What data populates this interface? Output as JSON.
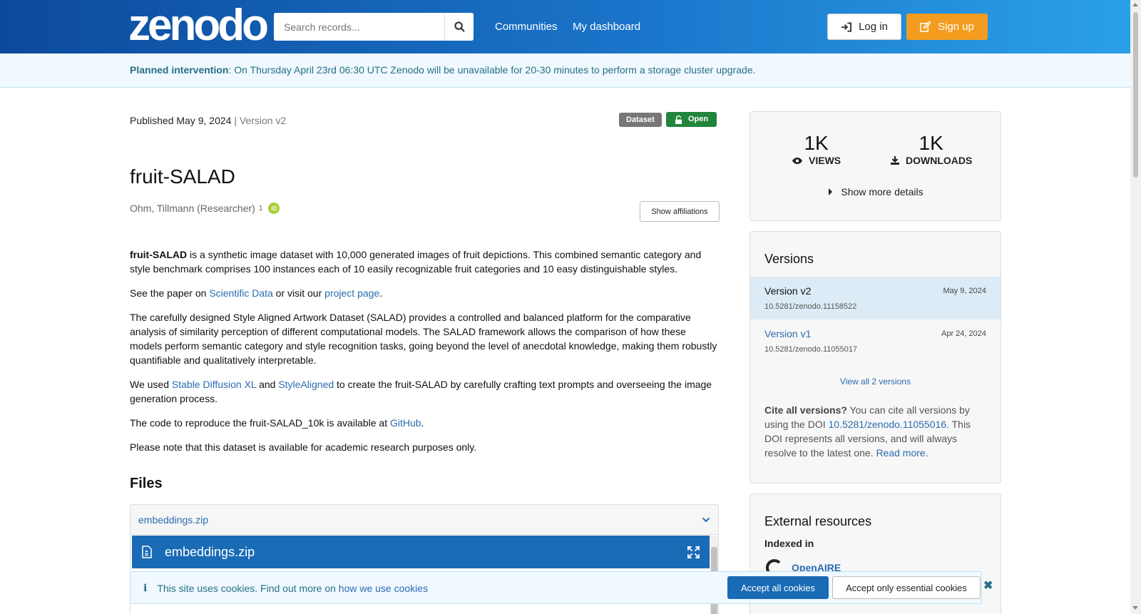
{
  "header": {
    "logo": "zenodo",
    "search_placeholder": "Search records...",
    "nav": [
      "Communities",
      "My dashboard"
    ],
    "login": "Log in",
    "signup": "Sign up"
  },
  "banner": {
    "bold": "Planned intervention",
    "text": ": On Thursday April 23rd 06:30 UTC Zenodo will be unavailable for 20-30 minutes to perform a storage cluster upgrade."
  },
  "record": {
    "published": "Published May 9, 2024",
    "version": "| Version v2",
    "badge_type": "Dataset",
    "badge_access": "Open",
    "title": "fruit-SALAD",
    "author": "Ohm, Tillmann (Researcher)",
    "author_sup": "1",
    "orcid": "iD",
    "show_affiliations": "Show affiliations",
    "desc": {
      "p1_bold": "fruit-SALAD",
      "p1": " is a synthetic image dataset with 10,000 generated images of fruit depictions. This combined semantic category and style benchmark comprises 100 instances each of 10 easily recognizable fruit categories and 10 easy distinguishable styles.",
      "p2_a": "See the paper on ",
      "p2_link1": "Scientific Data",
      "p2_b": " or visit our ",
      "p2_link2": "project page",
      "p2_c": ".",
      "p3": "The carefully designed Style Aligned Artwork Dataset (SALAD) provides a controlled and balanced platform for the comparative analysis of similarity perception of different computational models. The SALAD framework allows the comparison of how these models perform semantic category and style recognition tasks, going beyond the level of anecdotal knowledge, making them robustly quantifiable and qualitatively interpretable.",
      "p4_a": "We used ",
      "p4_link1": "Stable Diffusion XL",
      "p4_b": " and ",
      "p4_link2": "StyleAligned",
      "p4_c": " to create the fruit-SALAD by carefully crafting text prompts and overseeing the image generation process.",
      "p5_a": "The code to reproduce the fruit-SALAD_10k is available at ",
      "p5_link": "GitHub",
      "p5_b": ".",
      "p6": "Please note that this dataset is available for academic research purposes only."
    },
    "files_heading": "Files",
    "file_name": "embeddings.zip",
    "preview_name": "embeddings.zip"
  },
  "stats": {
    "views": "1K",
    "views_label": "VIEWS",
    "downloads": "1K",
    "downloads_label": "DOWNLOADS",
    "more": "Show more details"
  },
  "versions": {
    "heading": "Versions",
    "items": [
      {
        "name": "Version v2",
        "date": "May 9, 2024",
        "doi": "10.5281/zenodo.11158522"
      },
      {
        "name": "Version v1",
        "date": "Apr 24, 2024",
        "doi": "10.5281/zenodo.11055017"
      }
    ],
    "view_all": "View all 2 versions",
    "cite_bold": "Cite all versions?",
    "cite_a": " You can cite all versions by using the DOI ",
    "cite_doi": "10.5281/zenodo.11055016",
    "cite_b": ". This DOI represents all versions, and will always resolve to the latest one. ",
    "cite_more": "Read more."
  },
  "external": {
    "heading": "External resources",
    "indexed": "Indexed in",
    "openaire": "OpenAIRE"
  },
  "cookie": {
    "text": "This site uses cookies. Find out more on ",
    "link": "how we use cookies",
    "accept_all": "Accept all cookies",
    "accept_essential": "Accept only essential cookies"
  }
}
